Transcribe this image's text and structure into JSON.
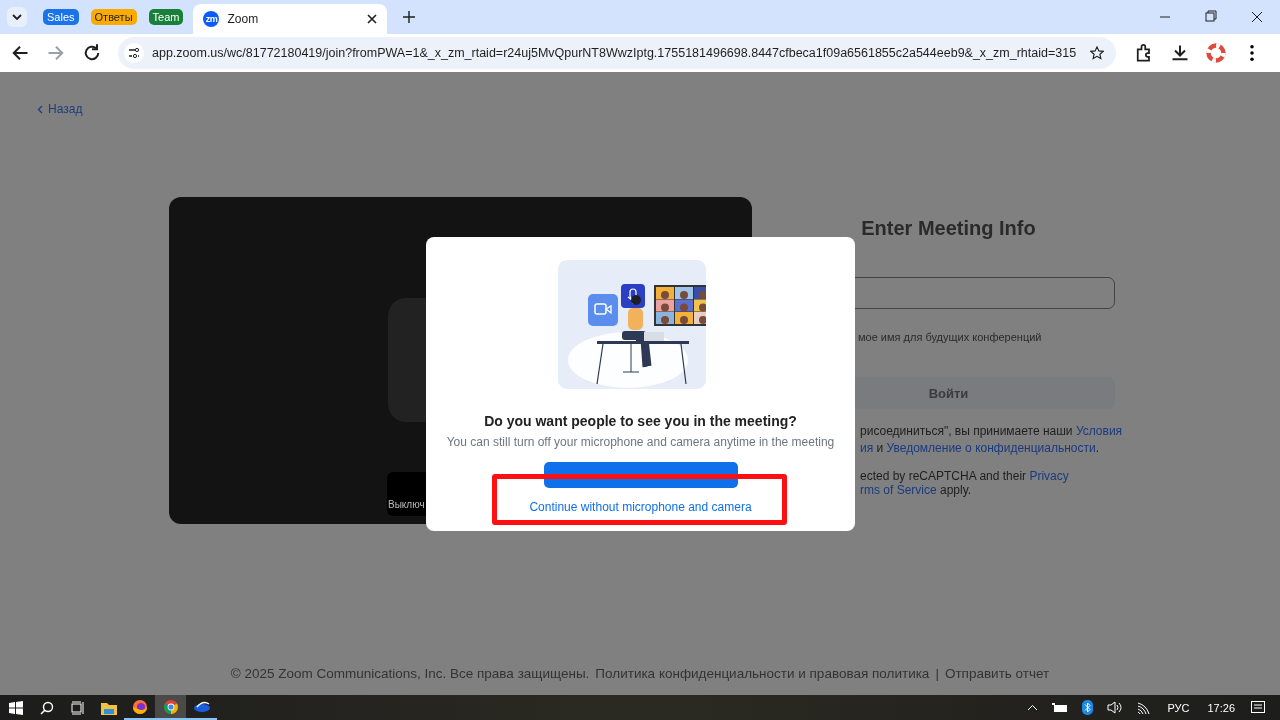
{
  "browser": {
    "tab_groups": [
      {
        "label": "Sales",
        "color": "#1a73e8"
      },
      {
        "label": "Ответы",
        "color": "#f9ab00"
      },
      {
        "label": "Team",
        "color": "#188038"
      }
    ],
    "tabs": [
      {
        "title": "Zoom",
        "favicon": "zm",
        "selected": true
      }
    ],
    "address": "app.zoom.us/wc/81772180419/join?fromPWA=1&_x_zm_rtaid=r24uj5MvQpurNT8WwzIptg.1755181496698.8447cfbeca1f09a6561855c2a544eeb9&_x_zm_rhtaid=315"
  },
  "page": {
    "back_link": "Назад",
    "preview": {
      "button_label": "Выключ"
    },
    "form": {
      "title": "Enter Meeting Info",
      "remember_label": "мое имя для будущих конференций",
      "join_button": "Войти",
      "terms_lines": [
        [
          {
            "text": "рисоединиться\", вы принимаете наши ",
            "kind": "text"
          },
          {
            "text": "Условия",
            "kind": "link"
          }
        ],
        [
          {
            "text": "ия",
            "kind": "link"
          },
          {
            "text": " и ",
            "kind": "text"
          },
          {
            "text": "Уведомление о конфиденциальности",
            "kind": "link"
          },
          {
            "text": ".",
            "kind": "text"
          }
        ]
      ],
      "recaptcha_lines": [
        [
          {
            "text": "ected by reCAPTCHA and their ",
            "kind": "text"
          },
          {
            "text": "Privacy",
            "kind": "link"
          }
        ],
        [
          {
            "text": "rms of Service",
            "kind": "link"
          },
          {
            "text": " apply.",
            "kind": "text"
          }
        ]
      ]
    },
    "footer": {
      "copyright": "© 2025 Zoom Communications, Inc. Все права защищены.",
      "links": [
        "Политика конфиденциальности и правовая политика",
        "Отправить отчет"
      ],
      "separator": "|"
    }
  },
  "dialog": {
    "title": "Do you want people to see you in the meeting?",
    "subtitle": "You can still turn off your microphone and camera anytime in the meeting",
    "secondary_link": "Continue without microphone and camera"
  },
  "taskbar": {
    "apps": [
      {
        "kind": "explorer",
        "running": false,
        "selected": false
      },
      {
        "kind": "firefox",
        "running": true,
        "selected": false
      },
      {
        "kind": "chrome",
        "running": true,
        "selected": true
      },
      {
        "kind": "zoom",
        "running": true,
        "selected": false
      }
    ],
    "language": "РУС",
    "time": "17:26"
  }
}
